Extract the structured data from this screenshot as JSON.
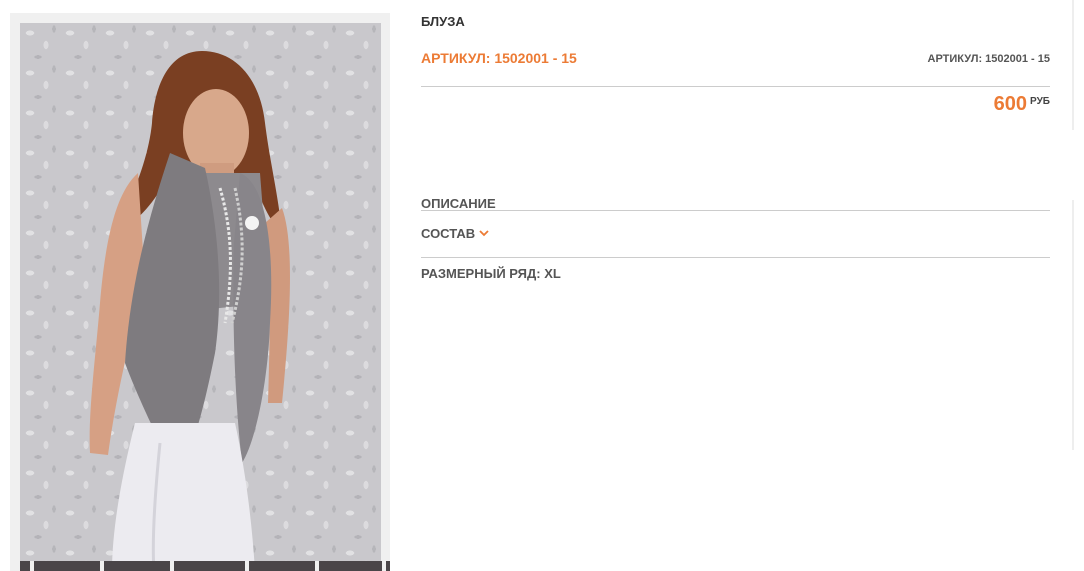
{
  "product": {
    "title": "БЛУЗА",
    "sku_primary": "АРТИКУЛ: 1502001 - 15",
    "sku_secondary": "АРТИКУЛ: 1502001 - 15",
    "price_value": "600",
    "price_currency": "РУБ"
  },
  "sections": {
    "description_label": "ОПИСАНИЕ",
    "composition_label": "СОСТАВ",
    "size_label": "РАЗМЕРНЫЙ РЯД:",
    "size_value": "XL"
  },
  "colors": {
    "accent": "#ec7b35",
    "text": "#555555",
    "rule": "#cccccc"
  },
  "icons": {
    "composition_toggle": "chevron-down-icon"
  }
}
